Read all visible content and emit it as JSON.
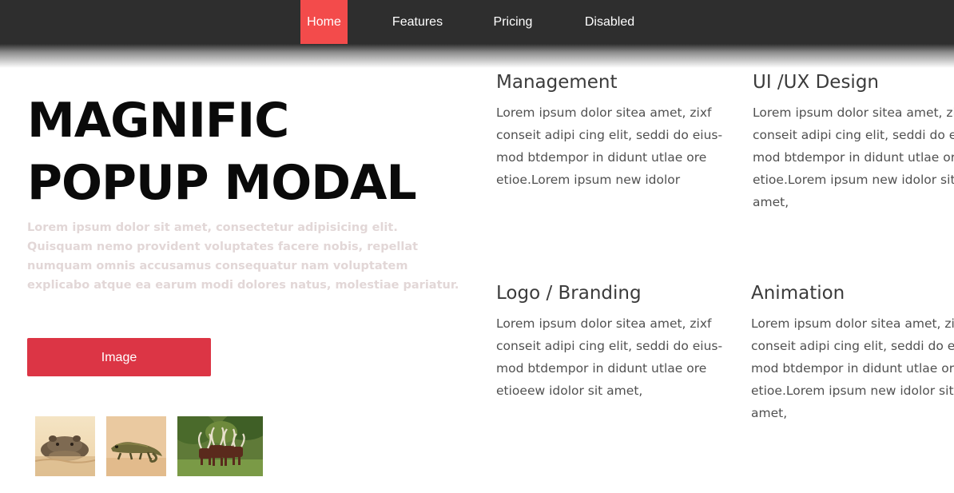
{
  "nav": {
    "items": [
      {
        "label": "Home",
        "active": true
      },
      {
        "label": "Features",
        "active": false
      },
      {
        "label": "Pricing",
        "active": false
      },
      {
        "label": "Disabled",
        "active": false
      }
    ],
    "background": "#2e2e2e",
    "active_color": "#f34b4b"
  },
  "hero": {
    "title_line1": "MAGNIFIC",
    "title_line2": "POPUP MODAL",
    "text": "Lorem ipsum dolor sit amet, consectetur adipisicing elit. Quisquam nemo provident voluptates facere nobis, repellat numquam omnis accusamus consequatur nam voluptatem explicabo atque ea earum modi dolores natus, molestiae pariatur.",
    "button_label": "Image",
    "button_color": "#dc3545"
  },
  "gallery": {
    "thumbnails": [
      {
        "name": "hippo"
      },
      {
        "name": "chameleon"
      },
      {
        "name": "cattle"
      }
    ]
  },
  "services": [
    {
      "title": "Management",
      "text": "Lorem ipsum dolor sitea amet, zixf\nconseit  adipi cing elit, seddi do eius-\nmod btdempor in didunt utlae ore\netioe.Lorem ipsum new idolor"
    },
    {
      "title": "UI /UX Design",
      "text": "Lorem ipsum dolor sitea amet, zixf\nconseit  adipi cing elit, seddi do eius-\nmod btdempor in didunt utlae ore\netioe.Lorem ipsum new idolor sit amet,"
    },
    {
      "title": "Logo / Branding",
      "text": "Lorem ipsum dolor sitea amet, zixf\nconseit  adipi cing elit, seddi do eius-\nmod btdempor in didunt utlae ore\netioeew idolor sit amet,"
    },
    {
      "title": "Animation",
      "text": "Lorem ipsum dolor sitea amet, zixf\nconseit  adipi cing elit, seddi do eius-\nmod btdempor in didunt utlae ore\netioe.Lorem ipsum new idolor sit amet,"
    }
  ]
}
